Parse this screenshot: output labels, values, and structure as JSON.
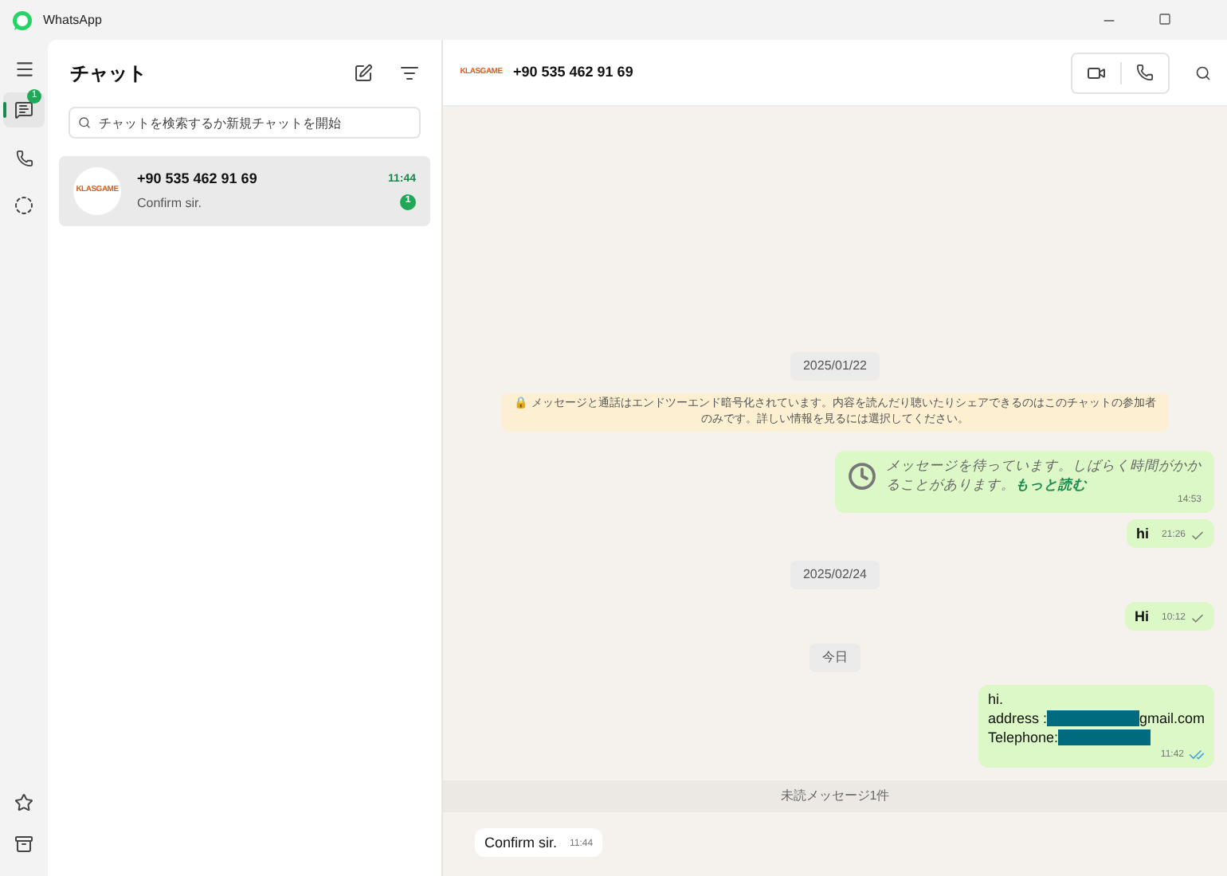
{
  "window": {
    "title": "WhatsApp"
  },
  "rail": {
    "items": [
      {
        "kind": "chats",
        "badge": "1",
        "selected": true
      },
      {
        "kind": "calls",
        "selected": false
      },
      {
        "kind": "status",
        "selected": false
      }
    ]
  },
  "chat_list": {
    "title": "チャット",
    "search": {
      "placeholder": "チャットを検索するか新規チャットを開始"
    },
    "items": [
      {
        "avatar_text": "KLASGAME",
        "name": "+90 535 462 91 69",
        "preview": "Confirm sir.",
        "time": "11:44",
        "unread": "1",
        "selected": true
      }
    ]
  },
  "conversation": {
    "avatar_text": "KLASGAME",
    "name": "+90 535 462 91 69",
    "messages": [
      {
        "kind": "date",
        "text": "2025/01/22"
      },
      {
        "kind": "notice",
        "text": "🔒 メッセージと通話はエンドツーエンド暗号化されています。内容を読んだり聴いたりシェアできるのはこのチャットの参加者のみです。詳しい情報を見るには選択してください。"
      },
      {
        "kind": "waiting",
        "text": "メッセージを待っています。しばらく時間がかかることがあります。",
        "link": "もっと読む",
        "time": "14:53"
      },
      {
        "kind": "out",
        "lines": [
          [
            {
              "text": "hi"
            }
          ]
        ],
        "time": "21:26",
        "read": false
      },
      {
        "kind": "date",
        "text": "2025/02/24"
      },
      {
        "kind": "out",
        "lines": [
          [
            {
              "text": "Hi"
            }
          ]
        ],
        "time": "10:12",
        "read": false
      },
      {
        "kind": "date",
        "text": "今日"
      },
      {
        "kind": "out",
        "lines": [
          [
            {
              "text": "hi."
            }
          ],
          [
            {
              "text": "address :"
            },
            {
              "kind": "redacted"
            },
            {
              "text": "gmail.com"
            }
          ],
          [
            {
              "text": "Telephone:"
            },
            {
              "kind": "redacted"
            }
          ]
        ],
        "time": "11:42",
        "read": true
      },
      {
        "kind": "unread",
        "text": "未読メッセージ1件"
      },
      {
        "kind": "in",
        "lines": [
          [
            {
              "text": "Confirm sir."
            }
          ]
        ],
        "time": "11:44"
      }
    ]
  }
}
